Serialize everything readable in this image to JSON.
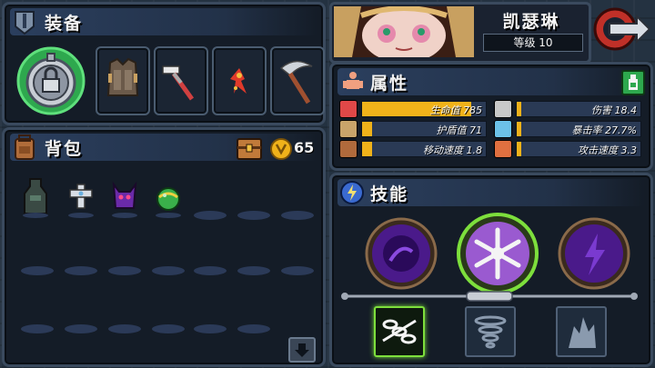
{
  "equipment": {
    "title": "装备",
    "slots": [
      {
        "icon": "pocket-watch-lock-icon"
      },
      {
        "icon": "armor-vest-icon"
      },
      {
        "icon": "hammer-icon"
      },
      {
        "icon": "flame-figure-icon"
      },
      {
        "icon": "scythe-icon"
      }
    ]
  },
  "backpack": {
    "title": "背包",
    "gold": "65",
    "items": [
      {
        "icon": "hooded-cloak-icon"
      },
      {
        "icon": "silver-cross-icon"
      },
      {
        "icon": "purple-demon-icon"
      },
      {
        "icon": "green-orb-icon"
      }
    ],
    "down_button": "arrow-down-icon"
  },
  "character": {
    "name": "凯瑟琳",
    "level_label": "等级 10"
  },
  "attributes": {
    "title": "属性",
    "stats": [
      {
        "icon": "heart-icon",
        "label": "生命值 785",
        "fill": 0.88,
        "color": "#e04848"
      },
      {
        "icon": "shield-icon",
        "label": "护盾值 71",
        "fill": 0.08,
        "color": "#c9a46a"
      },
      {
        "icon": "boot-icon",
        "label": "移动速度 1.8",
        "fill": 0.08,
        "color": "#b06a3c"
      },
      {
        "icon": "sword-icon",
        "label": "伤害 18.4",
        "fill": 0.04,
        "color": "#c8c8c8"
      },
      {
        "icon": "eye-icon",
        "label": "暴击率 27.7%",
        "fill": 0.04,
        "color": "#6cc2e8"
      },
      {
        "icon": "fist-icon",
        "label": "攻击速度 3.3",
        "fill": 0.04,
        "color": "#e07040"
      }
    ]
  },
  "skills": {
    "title": "技能",
    "orbs": [
      {
        "icon": "dark-void-icon"
      },
      {
        "icon": "snowflake-icon"
      },
      {
        "icon": "lightning-icon"
      }
    ],
    "buttons": [
      {
        "icon": "chains-icon"
      },
      {
        "icon": "tornado-icon"
      },
      {
        "icon": "shard-figure-icon"
      }
    ]
  },
  "colors": {
    "accent_gold": "#f0b21a",
    "selected_green": "#7ddf3c"
  }
}
